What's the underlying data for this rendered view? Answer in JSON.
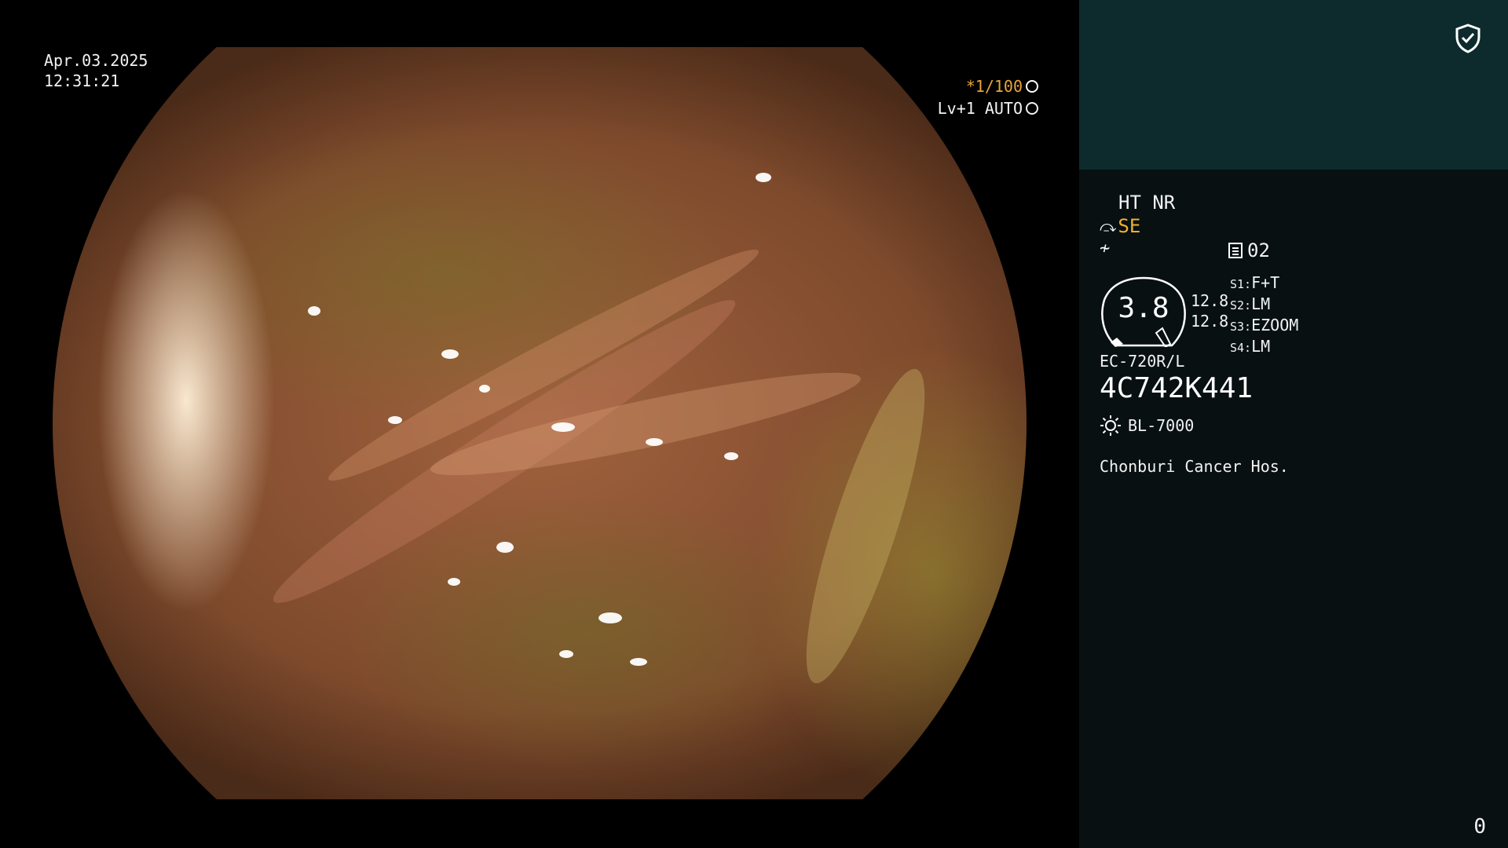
{
  "overlay": {
    "date": "Apr.03.2025",
    "time": "12:31:21",
    "shutter": "*1/100",
    "level": "Lv+1 AUTO"
  },
  "panel": {
    "mode": "HT NR",
    "enhancement": "SE",
    "channel": "02",
    "gauge_value": "3.8",
    "gauge_left": "12.8",
    "gauge_right": "12.8",
    "switches": [
      {
        "key": "S1:",
        "value": "F+T"
      },
      {
        "key": "S2:",
        "value": "LM"
      },
      {
        "key": "S3:",
        "value": "EZOOM"
      },
      {
        "key": "S4:",
        "value": "LM"
      }
    ],
    "scope_model": "EC-720R/L",
    "serial": "4C742K441",
    "light_source": "BL-7000",
    "hospital": "Chonburi Cancer Hos.",
    "counter": "0"
  },
  "icons": {
    "shield": "shield-check-icon",
    "aperture": "aperture-icon",
    "light": "sun-icon",
    "document": "document-icon"
  },
  "colors": {
    "accent_orange": "#f0b030",
    "panel_top": "#0d2b2c",
    "panel_bottom": "#081011"
  }
}
